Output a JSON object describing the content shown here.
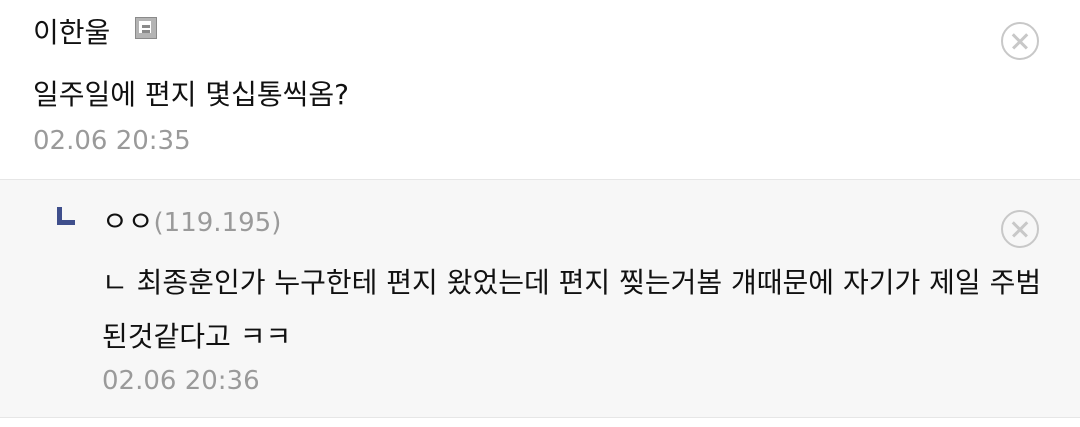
{
  "comments": [
    {
      "author": "이한울",
      "badge_icon": "member-badge-icon",
      "text": "일주일에 편지 몇십통씩옴?",
      "timestamp": "02.06 20:35"
    }
  ],
  "reply": {
    "author": "ㅇㅇ",
    "ip": "(119.195)",
    "text": "ㄴ 최종훈인가 누구한테 편지 왔었는데 편지 찢는거봄 걔때문에 자기가 제일 주범 된것같다고 ㅋㅋ",
    "timestamp": "02.06 20:36"
  },
  "colors": {
    "reply_background": "#f7f7f7",
    "reply_arrow": "#3f4f8c",
    "timestamp": "#9a9a9a",
    "delete_icon": "#c8c8c8"
  }
}
